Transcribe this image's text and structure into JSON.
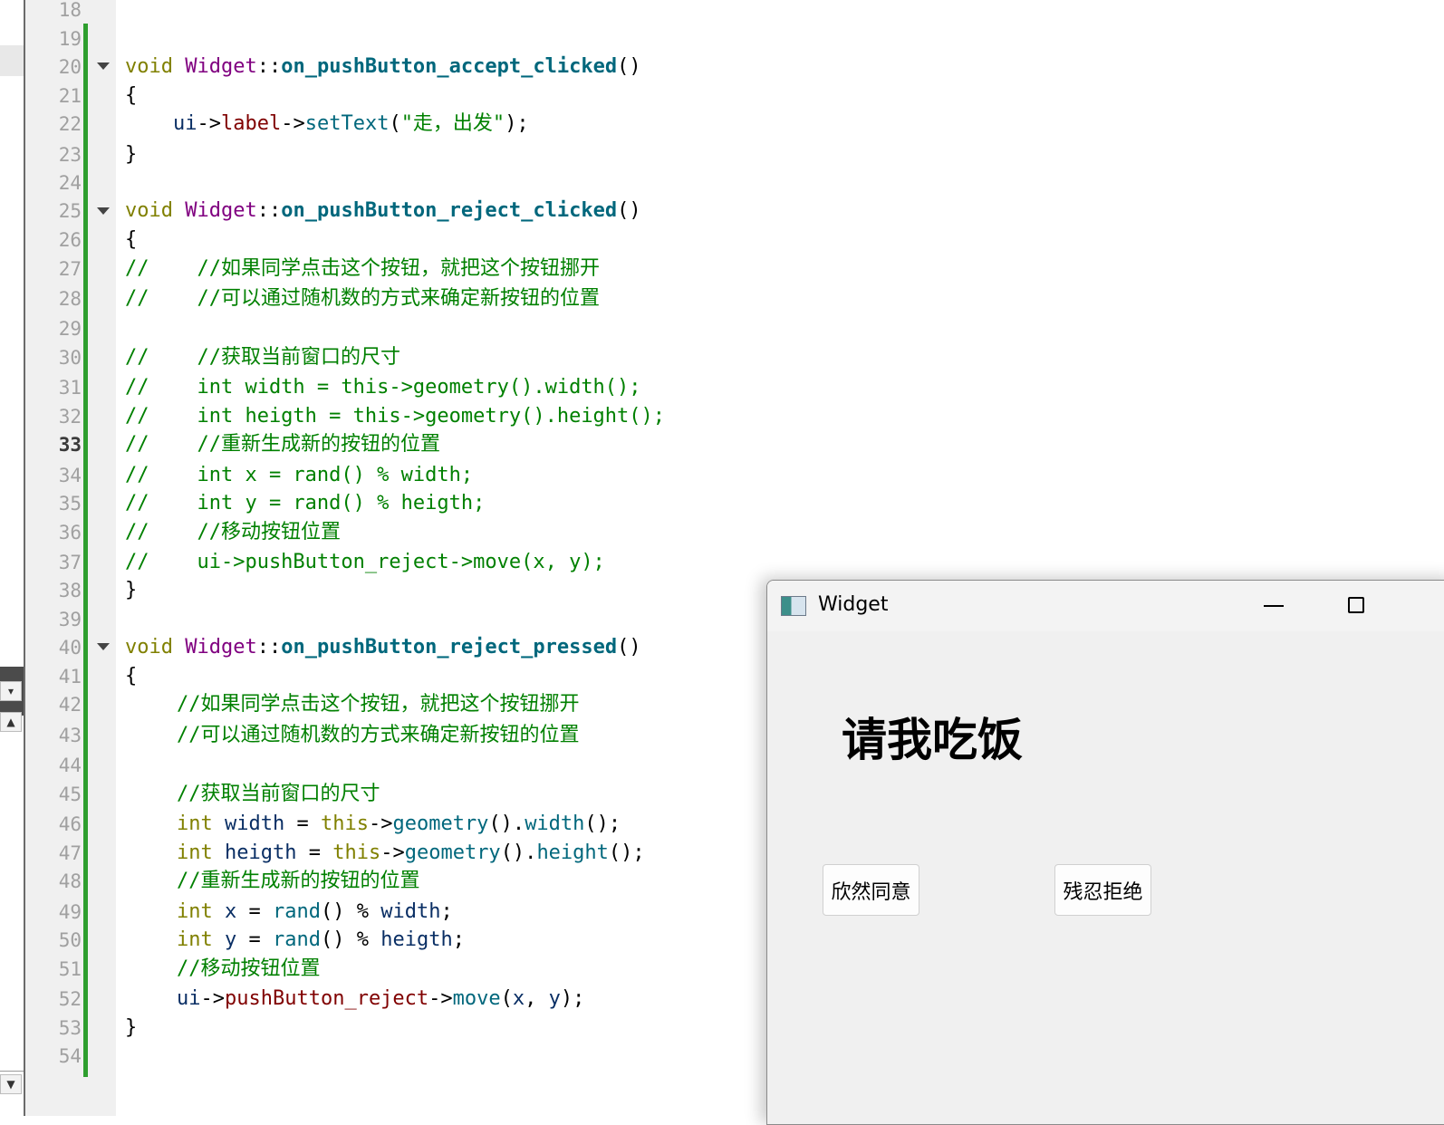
{
  "editor": {
    "current_line": "33",
    "line_numbers": [
      "18",
      "19",
      "20",
      "21",
      "22",
      "23",
      "24",
      "25",
      "26",
      "27",
      "28",
      "29",
      "30",
      "31",
      "32",
      "33",
      "34",
      "35",
      "36",
      "37",
      "38",
      "39",
      "40",
      "41",
      "42",
      "43",
      "44",
      "45",
      "46",
      "47",
      "48",
      "49",
      "50",
      "51",
      "52",
      "53",
      "54"
    ],
    "code": {
      "l20_kw": "void",
      "l20_cls": "Widget",
      "l20_sep": "::",
      "l20_fn": "on_pushButton_accept_clicked",
      "l20_end": "()",
      "l21": "{",
      "l22_ui": "ui",
      "l22_arrow1": "->",
      "l22_mem": "label",
      "l22_arrow2": "->",
      "l22_call": "setText",
      "l22_open": "(",
      "l22_str": "\"走，出发\"",
      "l22_end": ");",
      "l23": "}",
      "l25_kw": "void",
      "l25_cls": "Widget",
      "l25_sep": "::",
      "l25_fn": "on_pushButton_reject_clicked",
      "l25_end": "()",
      "l26": "{",
      "l27": "//    //如果同学点击这个按钮，就把这个按钮挪开",
      "l28": "//    //可以通过随机数的方式来确定新按钮的位置",
      "l30": "//    //获取当前窗口的尺寸",
      "l31": "//    int width = this->geometry().width();",
      "l32": "//    int heigth = this->geometry().height();",
      "l33": "//    //重新生成新的按钮的位置",
      "l34": "//    int x = rand() % width;",
      "l35": "//    int y = rand() % heigth;",
      "l36": "//    //移动按钮位置",
      "l37": "//    ui->pushButton_reject->move(x, y);",
      "l38": "}",
      "l40_kw": "void",
      "l40_cls": "Widget",
      "l40_sep": "::",
      "l40_fn": "on_pushButton_reject_pressed",
      "l40_end": "()",
      "l41": "{",
      "l42": "//如果同学点击这个按钮，就把这个按钮挪开",
      "l43": "//可以通过随机数的方式来确定新按钮的位置",
      "l45": "//获取当前窗口的尺寸",
      "l46_kw": "int",
      "l46_var": "width",
      "l46_eq": " = ",
      "l46_this": "this",
      "l46_arrow": "->",
      "l46_geo": "geometry",
      "l46_mid": "().",
      "l46_w": "width",
      "l46_end": "();",
      "l47_kw": "int",
      "l47_var": "heigth",
      "l47_eq": " = ",
      "l47_this": "this",
      "l47_arrow": "->",
      "l47_geo": "geometry",
      "l47_mid": "().",
      "l47_h": "height",
      "l47_end": "();",
      "l48": "//重新生成新的按钮的位置",
      "l49_kw": "int",
      "l49_var": "x",
      "l49_eq": " = ",
      "l49_rand": "rand",
      "l49_mid": "() % ",
      "l49_w": "width",
      "l49_end": ";",
      "l50_kw": "int",
      "l50_var": "y",
      "l50_eq": " = ",
      "l50_rand": "rand",
      "l50_mid": "() % ",
      "l50_h": "heigth",
      "l50_end": ";",
      "l51": "//移动按钮位置",
      "l52_ui": "ui",
      "l52_arrow1": "->",
      "l52_mem": "pushButton_reject",
      "l52_arrow2": "->",
      "l52_call": "move",
      "l52_open": "(",
      "l52_x": "x",
      "l52_comma": ", ",
      "l52_y": "y",
      "l52_end": ");",
      "l53": "}"
    }
  },
  "widget_window": {
    "title": "Widget",
    "label_text": "请我吃饭",
    "accept_button": "欣然同意",
    "reject_button": "残忍拒绝"
  },
  "icons": {
    "fold": "chevron-down-icon",
    "app": "qt-app-icon",
    "minimize": "minimize-icon",
    "maximize": "maximize-icon"
  },
  "colors": {
    "keyword": "#808000",
    "class": "#800080",
    "function": "#00677c",
    "comment": "#008000",
    "member": "#800000",
    "change_bar": "#2e9e2e"
  }
}
